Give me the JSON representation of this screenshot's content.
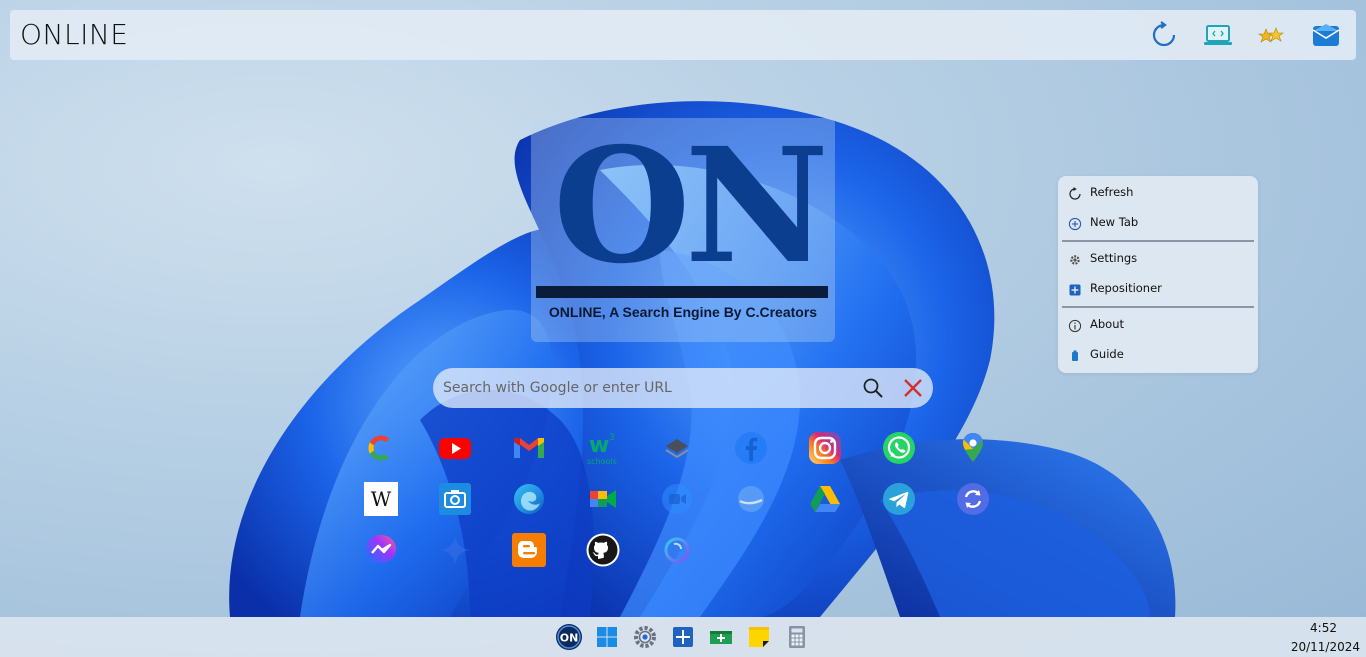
{
  "app": {
    "title": "ONLINE"
  },
  "topbar": {
    "icons": [
      "refresh-icon",
      "code-laptop-icon",
      "stars-icon",
      "mail-icon"
    ]
  },
  "logo": {
    "letters": "ON",
    "tagline": "ONLINE, A Search Engine By C.Creators"
  },
  "search": {
    "placeholder": "Search with Google or enter URL",
    "value": ""
  },
  "shortcuts": [
    "google",
    "youtube",
    "gmail",
    "w3schools",
    "layers",
    "facebook",
    "instagram",
    "whatsapp",
    "google-maps",
    "wikipedia",
    "camera",
    "edge",
    "google-meet",
    "zoom",
    "google-earth",
    "google-drive",
    "telegram",
    "sync",
    "messenger",
    "gemini",
    "blogger",
    "github",
    "copilot"
  ],
  "w3_label": "schools",
  "wiki_label": "W",
  "context_menu": {
    "items": [
      {
        "label": "Refresh",
        "icon": "refresh-icon"
      },
      {
        "label": "New Tab",
        "icon": "plus-circle-icon"
      },
      {
        "label": "Settings",
        "icon": "gear-icon"
      },
      {
        "label": "Repositioner",
        "icon": "repositioner-icon"
      },
      {
        "label": "About",
        "icon": "info-icon"
      },
      {
        "label": "Guide",
        "icon": "guide-icon"
      }
    ]
  },
  "taskbar": {
    "apps": [
      "online-logo",
      "windows-start",
      "settings",
      "repositioner",
      "add-app",
      "sticky-notes",
      "calculator"
    ],
    "logo_text": "ON",
    "time": "4:52",
    "date": "20/11/2024"
  },
  "colors": {
    "accent": "#0b3e8f",
    "menu_bg": "#e1e9f2",
    "topbar_bg": "#e2ecf5"
  }
}
